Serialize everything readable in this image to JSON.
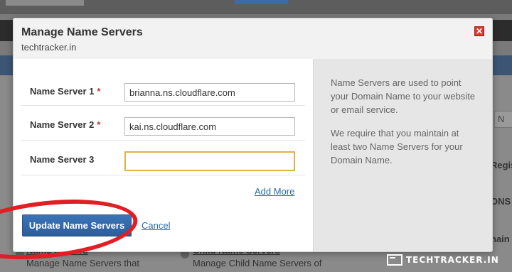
{
  "background": {
    "right_partial_labels": [
      "Regis",
      "ONS",
      "nain"
    ],
    "right_input_placeholder": "N",
    "bottom_items": [
      {
        "title": "Name Servers",
        "description": "Manage Name Servers that"
      },
      {
        "title": "Child Name Servers",
        "description": "Manage Child Name Servers of"
      }
    ]
  },
  "modal": {
    "title": "Manage Name Servers",
    "subtitle": "techtracker.in",
    "close_icon": "close-icon",
    "fields": [
      {
        "label": "Name Server 1",
        "required_mark": "*",
        "value": "brianna.ns.cloudflare.com"
      },
      {
        "label": "Name Server 2",
        "required_mark": "*",
        "value": "kai.ns.cloudflare.com"
      },
      {
        "label": "Name Server 3",
        "required_mark": "",
        "value": ""
      }
    ],
    "add_more_label": "Add More",
    "update_button_label": "Update Name Servers",
    "cancel_label": "Cancel",
    "info": {
      "paragraph1": "Name Servers are used to point your Domain Name to your website or email service.",
      "paragraph2": "We require that you maintain at least two Name Servers for your Domain Name."
    }
  },
  "watermark": {
    "text": "TECHTRACKER.IN"
  },
  "colors": {
    "accent": "#2c5d9a",
    "link": "#2a6aa3",
    "required": "#c0392b",
    "annotation": "#e01e24",
    "focus_border": "#e0b24a",
    "close": "#d9372a"
  }
}
